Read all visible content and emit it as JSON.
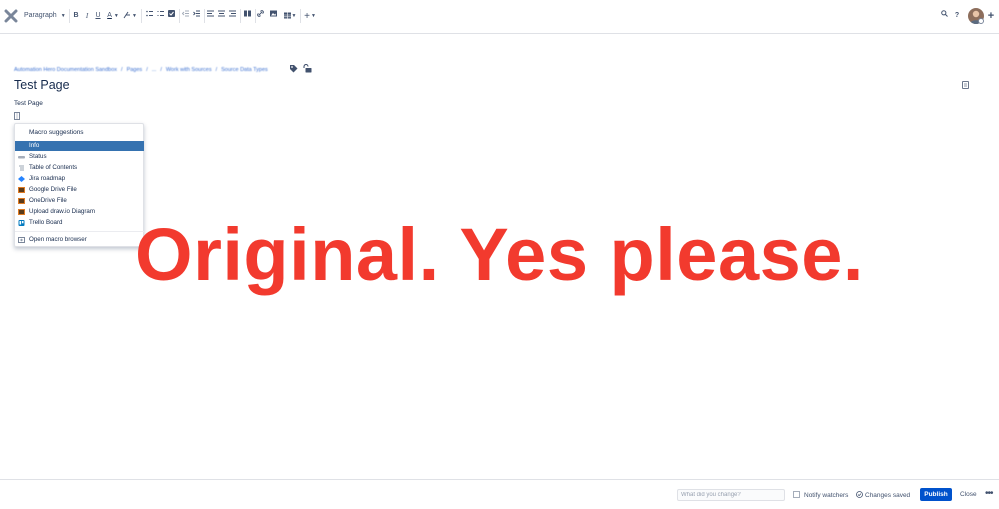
{
  "toolbar": {
    "paragraph_label": "Paragraph",
    "bold": "B",
    "italic": "I",
    "underline": "U",
    "text_color": "A",
    "search_icon": "⌕",
    "help_label": "?",
    "create_label": "+"
  },
  "breadcrumb": [
    "Automation Hero Documentation Sandbox",
    "/",
    "Pages",
    "/",
    "...",
    "/",
    "Work with Sources",
    "/",
    "Source Data Types"
  ],
  "page": {
    "title": "Test Page",
    "body_text": "Test Page"
  },
  "macro_menu": {
    "heading": "Macro suggestions",
    "items": [
      {
        "label": "Info",
        "selected": true,
        "icon": "info-icon"
      },
      {
        "label": "Status",
        "selected": false,
        "icon": "status-icon"
      },
      {
        "label": "Table of Contents",
        "selected": false,
        "icon": "toc-icon"
      },
      {
        "label": "Jira roadmap",
        "selected": false,
        "icon": "jira-icon"
      },
      {
        "label": "Google Drive File",
        "selected": false,
        "icon": "google-drive-icon"
      },
      {
        "label": "OneDrive File",
        "selected": false,
        "icon": "onedrive-icon"
      },
      {
        "label": "Upload draw.io Diagram",
        "selected": false,
        "icon": "drawio-icon"
      },
      {
        "label": "Trello Board",
        "selected": false,
        "icon": "trello-icon"
      }
    ],
    "browse_label": "Open macro browser"
  },
  "overlay_text": "Original. Yes please.",
  "footer": {
    "change_placeholder": "What did you change?",
    "notify_label": "Notify watchers",
    "saved_label": "Changes saved",
    "publish_label": "Publish",
    "close_label": "Close",
    "more_label": "•••"
  },
  "colors": {
    "accent": "#0052cc",
    "selected_row": "#3572b0",
    "overlay": "#f23a2e",
    "breadcrumb_link": "#3a6fd0"
  }
}
